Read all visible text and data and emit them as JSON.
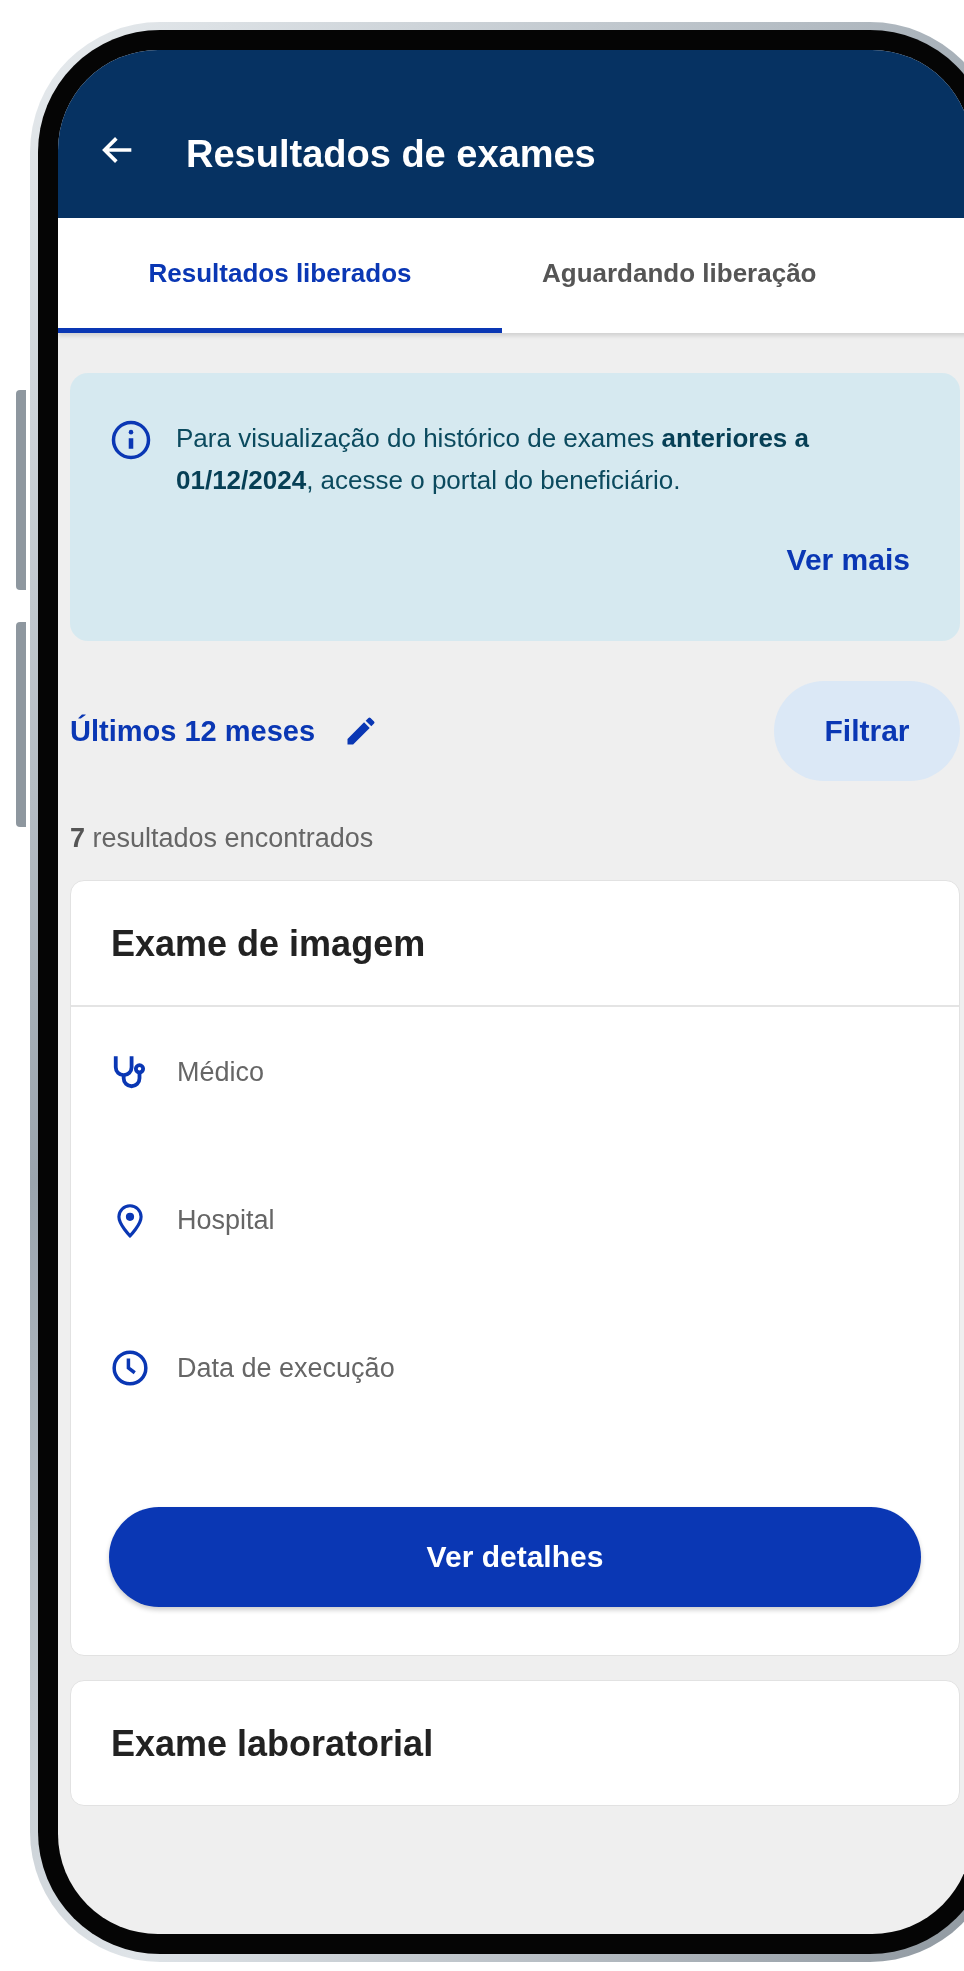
{
  "header": {
    "title": "Resultados de exames"
  },
  "tabs": [
    {
      "label": "Resultados liberados",
      "selected": true
    },
    {
      "label": "Aguardando liberação",
      "selected": false
    }
  ],
  "notice": {
    "text": "Para visualização do histórico de exames **anteriores a 01/12/2024**, acesse o portal do beneficiário.",
    "link": "Ver mais"
  },
  "period": {
    "label": "Últimos 12 meses"
  },
  "filter_button": "Filtrar",
  "results_count": "**7** resultados encontrados",
  "cards": [
    {
      "title": "Exame de imagem",
      "fields": [
        {
          "kind": "doctor",
          "label": "Médico"
        },
        {
          "kind": "location",
          "label": "Hospital"
        },
        {
          "kind": "date",
          "label": "Data de execução"
        }
      ],
      "button": "Ver detalhes"
    },
    {
      "title": "Exame laboratorial"
    }
  ]
}
